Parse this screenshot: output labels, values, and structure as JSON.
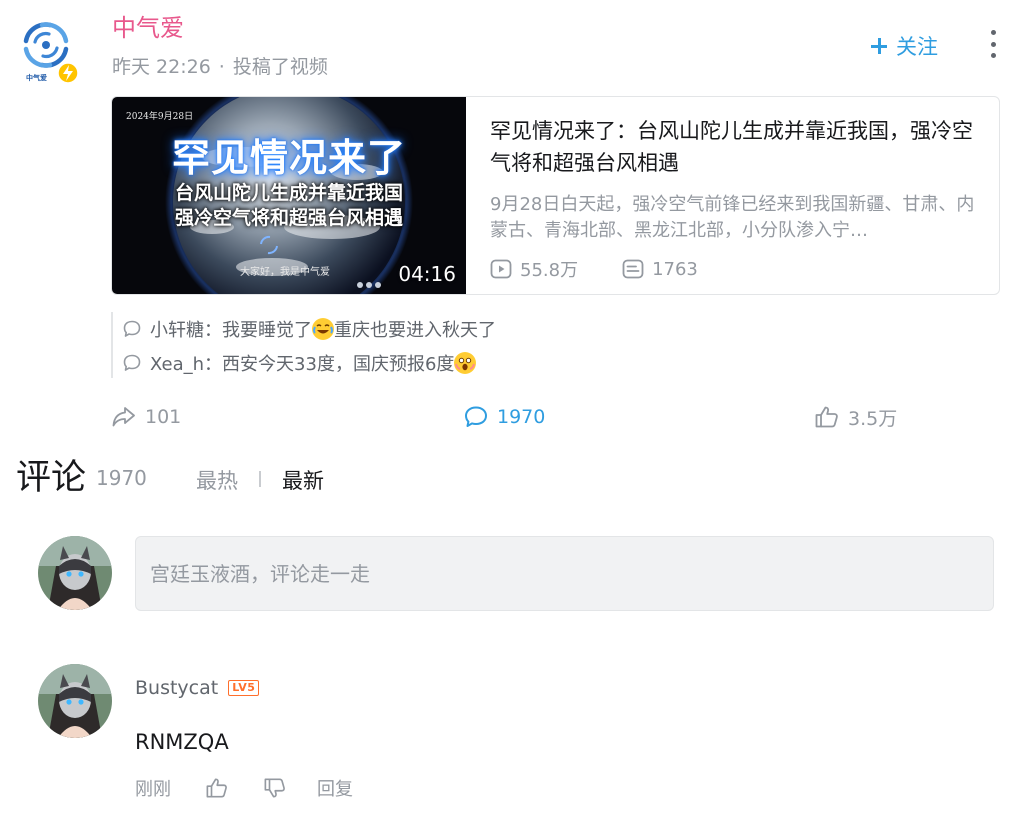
{
  "author": {
    "name": "中气爱",
    "time": "昨天 22:26",
    "separator": "·",
    "action": "投稿了视频",
    "logo_text": "中气爱"
  },
  "follow": {
    "label": "关注"
  },
  "video": {
    "thumbnail": {
      "date": "2024年9月28日",
      "headline": "罕见情况来了",
      "subline1": "台风山陀儿生成并靠近我国",
      "subline2": "强冷空气将和超强台风相遇",
      "caption": "大家好，我是中气爱",
      "duration": "04:16"
    },
    "title": "罕见情况来了：台风山陀儿生成并靠近我国，强冷空气将和超强台风相遇",
    "description": "9月28日白天起，强冷空气前锋已经来到我国新疆、甘肃、内蒙古、青海北部、黑龙江北部，小分队渗入宁…",
    "views": "55.8万",
    "danmaku": "1763"
  },
  "preview_comments": [
    {
      "name": "小轩糖",
      "colon": "：",
      "text_before": "我要睡觉了",
      "emoji": "cry-laugh-emoji",
      "text_after": "重庆也要进入秋天了"
    },
    {
      "name": "Xea_h",
      "colon": "：",
      "text_before": "西安今天33度，国庆预报6度",
      "emoji": "shocked-emoji",
      "text_after": ""
    }
  ],
  "actions": {
    "share": "101",
    "comment": "1970",
    "like": "3.5万"
  },
  "comments_section": {
    "title": "评论",
    "count": "1970",
    "sort_hot": "最热",
    "sort_new": "最新",
    "input_placeholder": "宫廷玉液酒，评论走一走"
  },
  "comment": {
    "user": "Bustycat",
    "level": "LV5",
    "text": "RNMZQA",
    "time": "刚刚",
    "reply": "回复"
  },
  "colors": {
    "accent_blue": "#2f9de0",
    "author_pink": "#e8588c",
    "level_orange": "#ff6f2c",
    "muted": "#9499a0"
  },
  "icons": [
    "weather-logo-icon",
    "bolt-badge-icon",
    "plus-icon",
    "more-dots-icon",
    "play-icon",
    "danmaku-icon",
    "chat-bubble-icon",
    "share-icon",
    "comment-icon",
    "thumb-up-icon",
    "thumb-down-icon",
    "avatar-image"
  ]
}
